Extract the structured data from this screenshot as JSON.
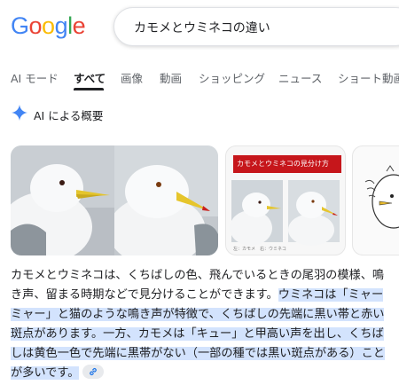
{
  "header": {
    "logo_letters": [
      "G",
      "o",
      "o",
      "g",
      "l",
      "e"
    ],
    "logo_colors": [
      "#4285F4",
      "#EA4335",
      "#FBBC05",
      "#4285F4",
      "#34A853",
      "#EA4335"
    ],
    "query": "カモメとウミネコの違い"
  },
  "tabs": [
    {
      "label": "AI モード"
    },
    {
      "label": "すべて",
      "active": true
    },
    {
      "label": "画像"
    },
    {
      "label": "動画"
    },
    {
      "label": "ショッピング"
    },
    {
      "label": "ニュース"
    },
    {
      "label": "ショート動画"
    }
  ],
  "ai_overview": {
    "label": "AI による概要",
    "accent": "#4285F4"
  },
  "images": {
    "card2_banner": "カモメとウミネコの見分け方",
    "card2_caption": "左：カモメ　右：ウミネコ"
  },
  "answer": {
    "plain": "カモメとウミネコは、くちばしの色、飛んでいるときの尾羽の模様、鳴き声、留まる時期などで見分けることができます。",
    "highlighted": "ウミネコは「ミャーミャー」と猫のような鳴き声が特徴で、くちばしの先端に黒い帯と赤い斑点があります。一方、カモメは「キュー」と甲高い声を出し、くちばしは黄色一色で先端に黒帯がない（一部の種では黒い斑点がある）ことが多いです。",
    "highlight_color": "#d3e3fd"
  }
}
